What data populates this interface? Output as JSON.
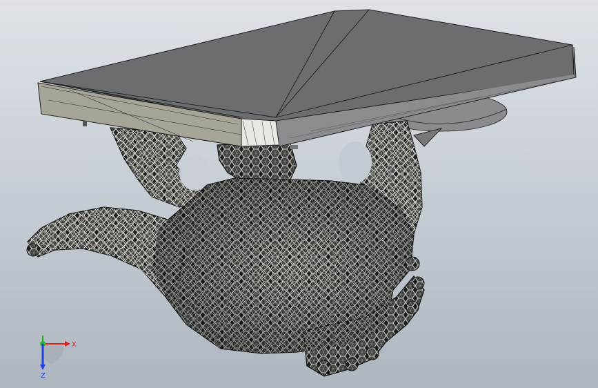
{
  "colors": {
    "background_top": "#d9dee4",
    "background_bottom": "#b0b8c1",
    "plate_top": "#6c6e72",
    "plate_edge_front": "#a8a79a",
    "plate_edge_side": "#8d8e92",
    "mesh_stroke": "#c9c9c2",
    "mesh_shadow": "#2a2a2a",
    "axis_x": "#e02020",
    "axis_y": "#20b020",
    "axis_z": "#2040e0"
  },
  "triad": {
    "x_label": "X",
    "z_label": "Z"
  }
}
